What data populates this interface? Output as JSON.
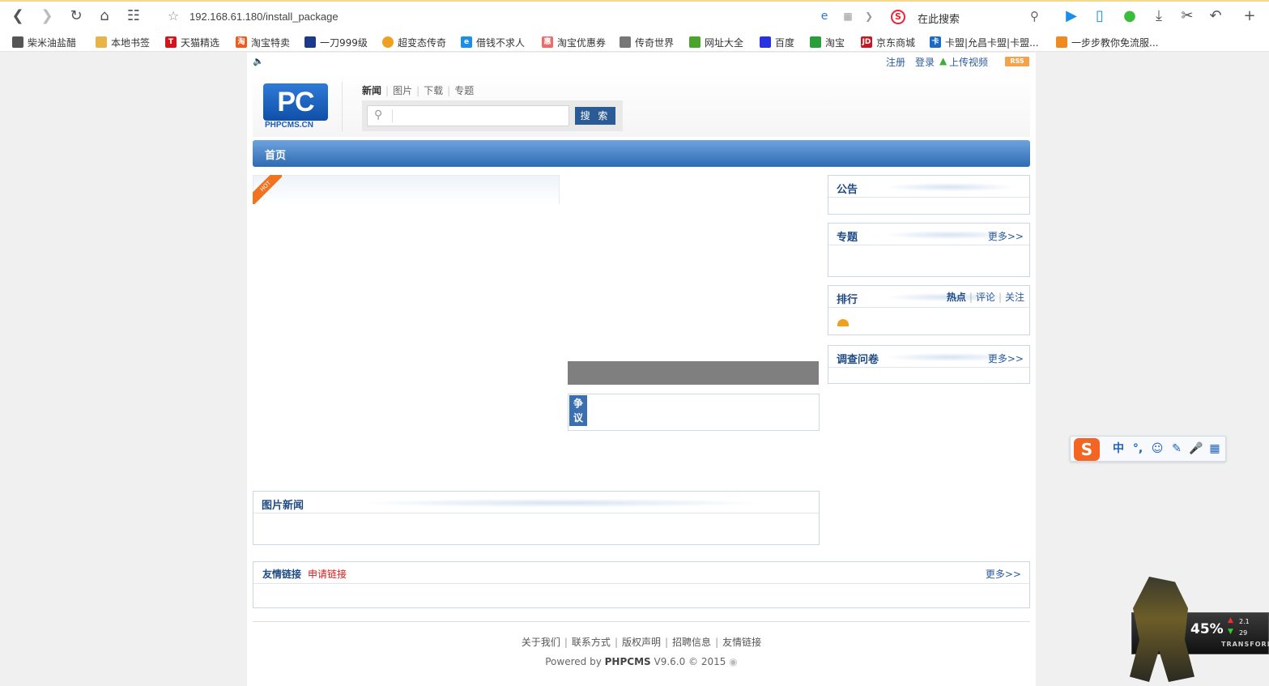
{
  "browser": {
    "url": "192.168.61.180/install_package",
    "search_placeholder": "在此搜索"
  },
  "bookmarks": [
    {
      "label": "柴米油盐醋",
      "icon": "paw-icon",
      "color": "#555555"
    },
    {
      "label": "本地书签",
      "icon": "folder-icon",
      "color": "#e8b44a"
    },
    {
      "label": "天猫精选",
      "icon": "tmall-icon",
      "color": "#d4161c"
    },
    {
      "label": "淘宝特卖",
      "icon": "taobao-icon",
      "color": "#f25a1c"
    },
    {
      "label": "一刀999级",
      "icon": "game-icon",
      "color": "#1c3a8c"
    },
    {
      "label": "超变态传奇",
      "icon": "smile-icon",
      "color": "#f0a020"
    },
    {
      "label": "借钱不求人",
      "icon": "e-icon",
      "color": "#1a8ee8"
    },
    {
      "label": "淘宝优惠券",
      "icon": "coupon-icon",
      "color": "#f06a6a"
    },
    {
      "label": "传奇世界",
      "icon": "sword-icon",
      "color": "#555555"
    },
    {
      "label": "网址大全",
      "icon": "hao-icon",
      "color": "#4aa52a"
    },
    {
      "label": "百度",
      "icon": "baidu-icon",
      "color": "#2932e1"
    },
    {
      "label": "淘宝",
      "icon": "tao-icon",
      "color": "#2a9e3a"
    },
    {
      "label": "京东商城",
      "icon": "jd-icon",
      "color": "#c81623"
    },
    {
      "label": "卡盟|允昌卡盟|卡盟...",
      "icon": "card-icon",
      "color": "#1a6bc4"
    },
    {
      "label": "一步步教你免流服...",
      "icon": "teach-icon",
      "color": "#f08a20"
    }
  ],
  "top_links": {
    "register": "注册",
    "login": "登录",
    "upload_video": "上传视频",
    "rss": "RSS"
  },
  "logo": {
    "mark": "PC",
    "caption": "PHPCMS.CN"
  },
  "categories": [
    {
      "label": "新闻",
      "current": true
    },
    {
      "label": "图片",
      "current": false
    },
    {
      "label": "下载",
      "current": false
    },
    {
      "label": "专题",
      "current": false
    }
  ],
  "search": {
    "value": "",
    "button": "搜 索"
  },
  "nav": {
    "home": "首页"
  },
  "hot_badge": "HOT",
  "debate_tag": "争议",
  "sidebar": {
    "notice": {
      "title": "公告"
    },
    "special": {
      "title": "专题",
      "more": "更多>>"
    },
    "ranking": {
      "title": "排行",
      "tabs": [
        "热点",
        "评论",
        "关注"
      ]
    },
    "survey": {
      "title": "调查问卷",
      "more": "更多>>"
    }
  },
  "photo_news": {
    "title": "图片新闻"
  },
  "friend_links": {
    "title": "友情链接",
    "apply": "申请链接",
    "more": "更多>>"
  },
  "footer": {
    "links": [
      "关于我们",
      "联系方式",
      "版权声明",
      "招聘信息",
      "友情链接"
    ],
    "powered_prefix": "Powered by",
    "powered_brand": "PHPCMS",
    "powered_suffix": "V9.6.0 © 2015"
  },
  "ime": {
    "mode": "中"
  },
  "widget": {
    "percent": "45%",
    "upload": "2.1",
    "download": "29",
    "brand": "TRANSFORM"
  }
}
